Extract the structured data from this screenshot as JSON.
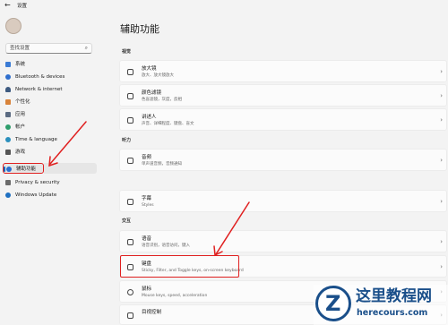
{
  "titlebar": {
    "back_glyph": "←",
    "title": "设置"
  },
  "search": {
    "placeholder": "查找设置"
  },
  "sidebar": {
    "items": [
      {
        "label": "系统",
        "icon": "monitor-icon",
        "color": "#3a7bd5"
      },
      {
        "label": "Bluetooth & devices",
        "icon": "bluetooth-icon",
        "color": "#2f6fce"
      },
      {
        "label": "Network & internet",
        "icon": "wifi-icon",
        "color": "#3d5a80"
      },
      {
        "label": "个性化",
        "icon": "brush-icon",
        "color": "#d8833a"
      },
      {
        "label": "应用",
        "icon": "apps-icon",
        "color": "#5b6b82"
      },
      {
        "label": "帐户",
        "icon": "person-icon",
        "color": "#2e9d6b"
      },
      {
        "label": "Time & language",
        "icon": "globe-clock-icon",
        "color": "#2a8fbd"
      },
      {
        "label": "游戏",
        "icon": "gamepad-icon",
        "color": "#555555"
      },
      {
        "label": "辅助功能",
        "icon": "accessibility-icon",
        "color": "#2a6fcf",
        "active": true
      },
      {
        "label": "Privacy & security",
        "icon": "shield-icon",
        "color": "#6b6b6b"
      },
      {
        "label": "Windows Update",
        "icon": "update-icon",
        "color": "#1f70c1"
      }
    ]
  },
  "page": {
    "title": "辅助功能"
  },
  "sections": {
    "vision": "视觉",
    "hearing": "听力",
    "interaction_header": "交互"
  },
  "cards": [
    {
      "title": "放大镜",
      "subtitle": "放大、放大镜放大",
      "icon": "magnifier-icon"
    },
    {
      "title": "颜色滤镜",
      "subtitle": "色盲滤镜，灰度，反相",
      "icon": "color-filter-icon"
    },
    {
      "title": "讲述人",
      "subtitle": "声音、详细程度、键盘、盲文",
      "icon": "narrator-icon"
    },
    {
      "title": "音频",
      "subtitle": "单声道音频，音频通知",
      "icon": "speaker-icon"
    },
    {
      "title": "字幕",
      "subtitle": "Styles",
      "icon": "captions-icon"
    },
    {
      "title": "语音",
      "subtitle": "语音识别，语音访问，键入",
      "icon": "microphone-icon"
    },
    {
      "title": "键盘",
      "subtitle": "Sticky, Filter, and Toggle keys, on-screen keyboard",
      "icon": "keyboard-icon"
    },
    {
      "title": "鼠标",
      "subtitle": "Mouse keys, speed, acceleration",
      "icon": "mouse-icon"
    },
    {
      "title": "目视控制",
      "subtitle": "",
      "icon": "eye-icon"
    }
  ],
  "accent": "#0067c0",
  "highlight_color": "#e02020",
  "watermark": {
    "glyph": "Z",
    "text": "这里教程网",
    "url": "herecours.com"
  }
}
